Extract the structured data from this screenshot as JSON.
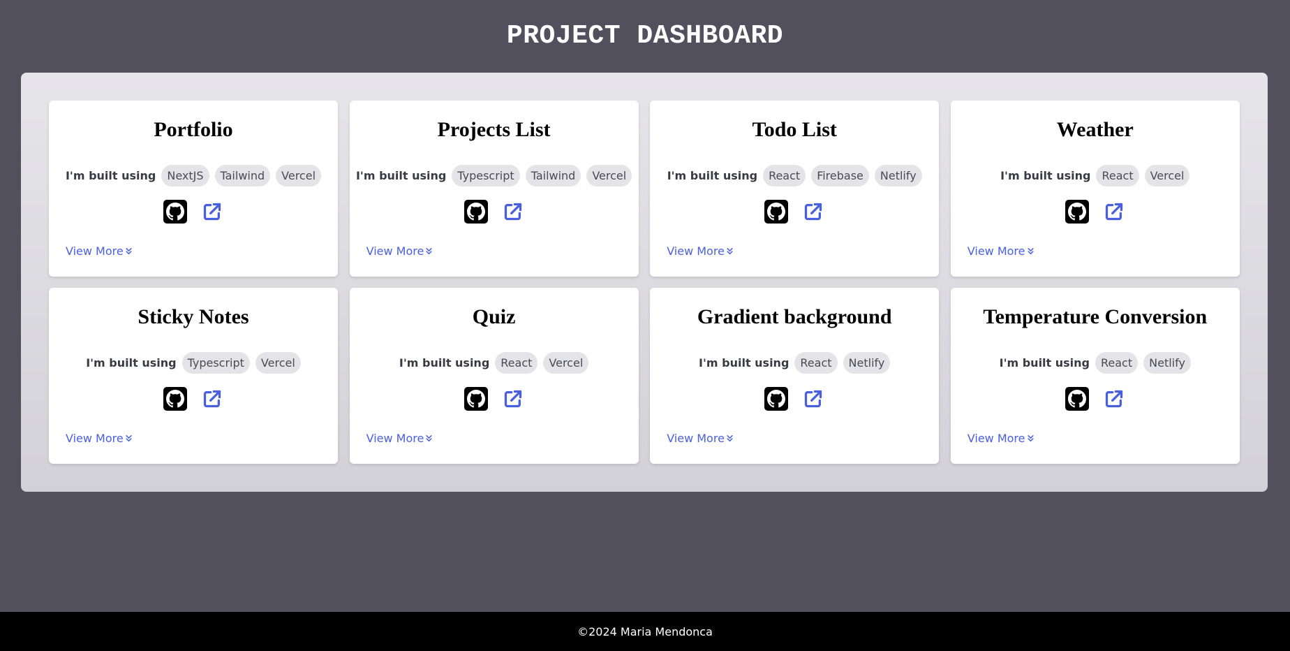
{
  "header": {
    "title": "PROJECT DASHBOARD"
  },
  "built_label": "I'm built using",
  "view_more_label": "View More",
  "accent_color": "#4a5fe0",
  "projects": [
    {
      "title": "Portfolio",
      "tags": [
        "NextJS",
        "Tailwind",
        "Vercel"
      ]
    },
    {
      "title": "Projects List",
      "tags": [
        "Typescript",
        "Tailwind",
        "Vercel"
      ]
    },
    {
      "title": "Todo List",
      "tags": [
        "React",
        "Firebase",
        "Netlify"
      ]
    },
    {
      "title": "Weather",
      "tags": [
        "React",
        "Vercel"
      ]
    },
    {
      "title": "Sticky Notes",
      "tags": [
        "Typescript",
        "Vercel"
      ]
    },
    {
      "title": "Quiz",
      "tags": [
        "React",
        "Vercel"
      ]
    },
    {
      "title": "Gradient background",
      "tags": [
        "React",
        "Netlify"
      ]
    },
    {
      "title": "Temperature Conversion",
      "tags": [
        "React",
        "Netlify"
      ]
    }
  ],
  "icons": {
    "repo": "github-icon",
    "live": "external-link-icon",
    "expand": "chevrons-down-icon"
  },
  "footer": {
    "text": "©2024 Maria Mendonca"
  }
}
